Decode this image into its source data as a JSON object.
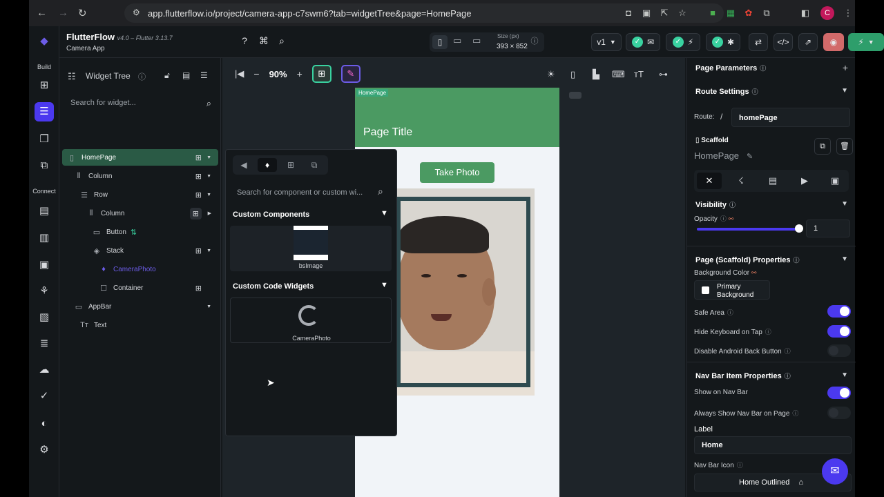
{
  "browser": {
    "url": "app.flutterflow.io/project/camera-app-c7swm6?tab=widgetTree&page=HomePage",
    "avatar_letter": "C"
  },
  "app": {
    "brand": "FlutterFlow",
    "version": "v4.0 – Flutter 3.13.7",
    "project": "Camera App",
    "rail": {
      "build_label": "Build",
      "connect_label": "Connect"
    },
    "device_size_label": "Size (px)",
    "device_size": "393 × 852",
    "branch": "v1"
  },
  "tree": {
    "title": "Widget Tree",
    "search_placeholder": "Search for widget...",
    "items": [
      {
        "label": "HomePage",
        "icon": "phone-icon"
      },
      {
        "label": "Column",
        "icon": "column-icon"
      },
      {
        "label": "Row",
        "icon": "row-icon"
      },
      {
        "label": "Column",
        "icon": "column-icon"
      },
      {
        "label": "Button",
        "icon": "button-icon"
      },
      {
        "label": "Stack",
        "icon": "stack-icon"
      },
      {
        "label": "CameraPhoto",
        "icon": "gem-icon"
      },
      {
        "label": "Container",
        "icon": "container-icon"
      },
      {
        "label": "AppBar",
        "icon": "appbar-icon"
      },
      {
        "label": "Text",
        "icon": "text-icon"
      }
    ],
    "selected_color": "#2a5a45",
    "highlight_color": "#4b39ef"
  },
  "canvas": {
    "zoom": "90%",
    "page_tag": "HomePage",
    "page_title": "Page Title",
    "button_label": "Take Photo"
  },
  "palette": {
    "search_placeholder": "Search for component or custom wi...",
    "sections": [
      {
        "title": "Custom Components",
        "card_label": "bsImage"
      },
      {
        "title": "Custom Code Widgets",
        "card_label": "CameraPhoto"
      }
    ]
  },
  "props": {
    "page_parameters": "Page Parameters",
    "route_settings": "Route Settings",
    "route_label": "Route:",
    "route_sep": "/",
    "route_value": "homePage",
    "scaffold_label": "Scaffold",
    "scaffold_name": "HomePage",
    "visibility": "Visibility",
    "opacity_label": "Opacity",
    "opacity_value": "1",
    "scaffold_props": "Page (Scaffold) Properties",
    "bg_color_label": "Background Color",
    "bg_color_value": "Primary Background",
    "safe_area": "Safe Area",
    "hide_keyboard": "Hide Keyboard on Tap",
    "disable_back": "Disable Android Back Button",
    "nav_bar_props": "Nav Bar Item Properties",
    "show_on_nav": "Show on Nav Bar",
    "always_show_nav": "Always Show Nav Bar on Page",
    "label_label": "Label",
    "label_value": "Home",
    "nav_icon_label": "Nav Bar Icon",
    "nav_icon_value": "Home Outlined",
    "accent": "#4b39ef"
  }
}
